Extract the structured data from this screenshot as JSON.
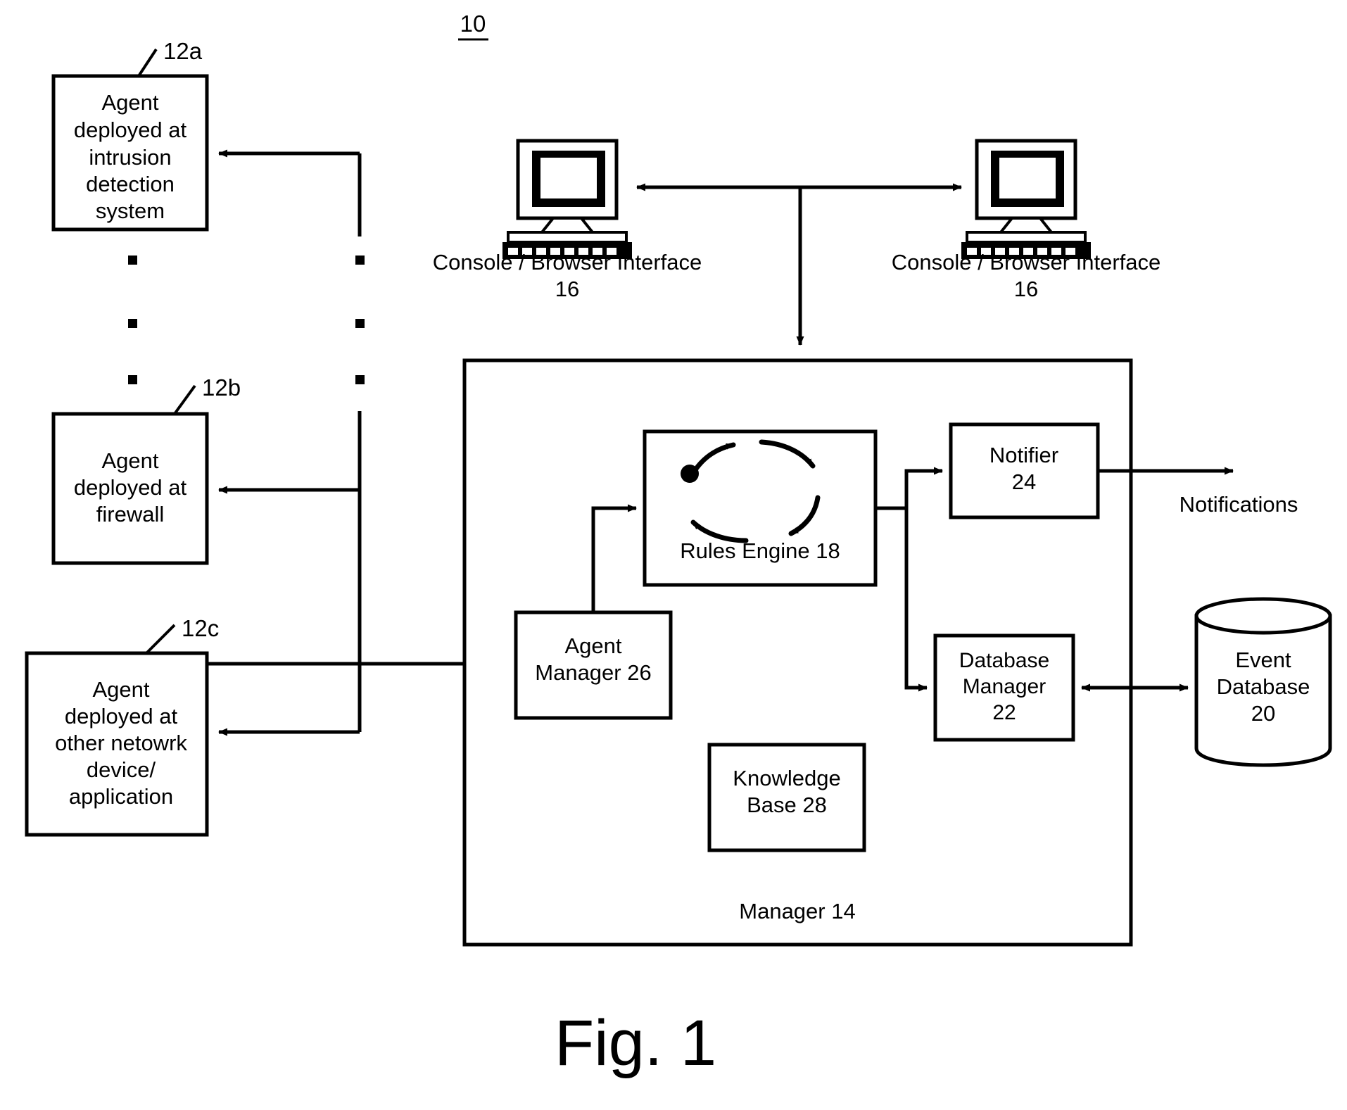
{
  "figure": {
    "number_label": "10",
    "caption": "Fig. 1",
    "system_box_label": "Manager 14"
  },
  "agents": [
    {
      "ref": "12a",
      "lines": [
        "Agent",
        "deployed at",
        "intrusion",
        "detection",
        "system"
      ]
    },
    {
      "ref": "12b",
      "lines": [
        "Agent",
        "deployed at",
        "firewall"
      ]
    },
    {
      "ref": "12c",
      "lines": [
        "Agent",
        "deployed at",
        "other netowrk",
        "device/",
        "application"
      ]
    }
  ],
  "consoles": [
    {
      "label": "Console / Browser Interface",
      "ref": "16",
      "icon": "desktop-computer-icon"
    },
    {
      "label": "Console / Browser Interface",
      "ref": "16",
      "icon": "desktop-computer-icon"
    }
  ],
  "manager_components": {
    "rules_engine": {
      "label": "Rules Engine 18",
      "icon": "cycle-arrows-icon"
    },
    "agent_manager": {
      "lines": [
        "Agent",
        "Manager 26"
      ]
    },
    "knowledge_base": {
      "lines": [
        "Knowledge",
        "Base 28"
      ]
    },
    "notifier": {
      "lines": [
        "Notifier",
        "24"
      ]
    },
    "database_manager": {
      "lines": [
        "Database",
        "Manager",
        "22"
      ]
    }
  },
  "external": {
    "event_database": {
      "lines": [
        "Event",
        "Database",
        "20"
      ],
      "icon": "database-cylinder-icon"
    },
    "notifications_label": "Notifications"
  },
  "ellipsis_dots": {
    "count_left": 3,
    "count_right": 3
  },
  "colors": {
    "ink": "#000000",
    "paper": "#ffffff"
  }
}
